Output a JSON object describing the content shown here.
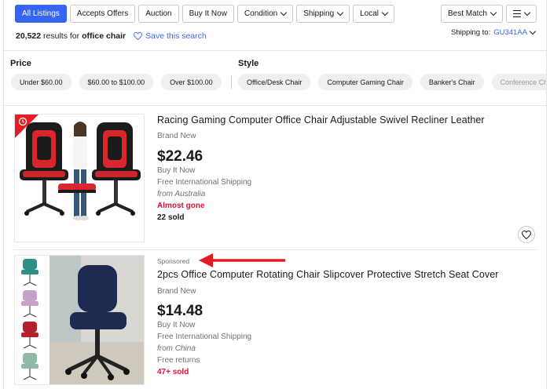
{
  "filters": {
    "all_listings": "All Listings",
    "accepts_offers": "Accepts Offers",
    "auction": "Auction",
    "buy_it_now": "Buy It Now",
    "condition": "Condition",
    "shipping": "Shipping",
    "local": "Local"
  },
  "sort": {
    "label": "Best Match"
  },
  "results": {
    "count": "20,522",
    "text": "results for",
    "query": "office chair",
    "save_search": "Save this search"
  },
  "shipping_to": {
    "label": "Shipping to:",
    "location": "GU341AA"
  },
  "aspects": {
    "price": {
      "title": "Price",
      "options": [
        "Under $60.00",
        "$60.00 to $100.00",
        "Over $100.00"
      ]
    },
    "style": {
      "title": "Style",
      "options": [
        "Office/Desk Chair",
        "Computer Gaming Chair",
        "Banker's Chair",
        "Conference Ch"
      ]
    }
  },
  "items": [
    {
      "title": "Racing Gaming Computer Office Chair Adjustable Swivel Recliner Leather",
      "condition": "Brand New",
      "price": "$22.46",
      "format": "Buy It Now",
      "shipping": "Free International Shipping",
      "location": "from Australia",
      "urgency": "Almost gone",
      "sold": "22 sold"
    },
    {
      "sponsored": "Sponsored",
      "title": "2pcs Office Computer Rotating Chair Slipcover Protective Stretch Seat Cover",
      "condition": "Brand New",
      "price": "$14.48",
      "format": "Buy It Now",
      "shipping": "Free International Shipping",
      "location": "from China",
      "returns": "Free returns",
      "sold": "47+ sold"
    }
  ],
  "colors": {
    "accent": "#3665f3",
    "urgent": "#e0103a",
    "arrow": "#e01b22"
  },
  "icons": [
    "chevron-down-icon",
    "list-view-icon",
    "heart-icon",
    "clock-badge-icon"
  ]
}
